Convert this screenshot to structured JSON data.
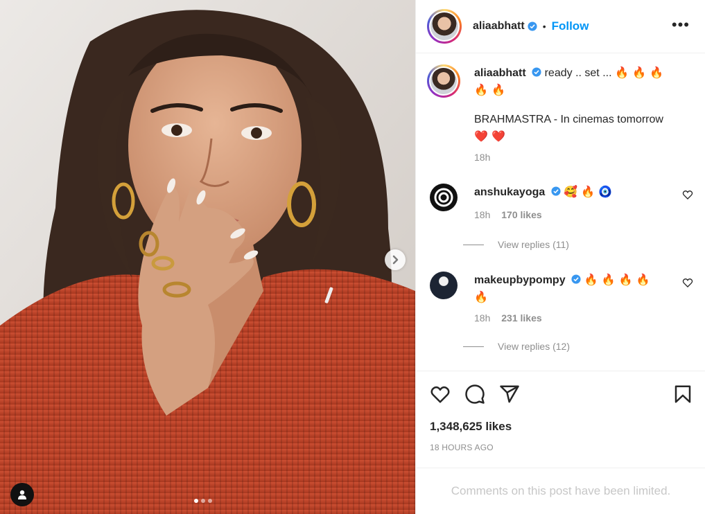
{
  "post": {
    "author": "aliaabhatt",
    "follow_label": "Follow",
    "separator": "•",
    "more_label": "•••"
  },
  "caption": {
    "username": "aliaabhatt",
    "text": "ready .. set ...",
    "emoji_line1": "🔥 🔥 🔥",
    "emoji_line2": "🔥 🔥",
    "line2": "BRAHMASTRA - In cinemas tomorrow",
    "hearts": "❤️ ❤️",
    "time": "18h"
  },
  "comments": [
    {
      "username": "anshukayoga",
      "text": "🥰 🔥 🧿",
      "time": "18h",
      "likes": "170 likes",
      "replies": "View replies (11)"
    },
    {
      "username": "makeupbypompy",
      "text": "🔥 🔥 🔥 🔥",
      "text2": "🔥",
      "time": "18h",
      "likes": "231 likes",
      "replies": "View replies (12)"
    }
  ],
  "likes_count": "1,348,625 likes",
  "timestamp": "18 HOURS AGO",
  "comments_limited": "Comments on this post have been limited.",
  "carousel": {
    "total": 3,
    "active": 1
  },
  "colors": {
    "accent": "#0095f6",
    "verified": "#3897f0",
    "muted": "#8e8e8e",
    "sweater": "#c2452c"
  },
  "icons": [
    "chevron-right-icon",
    "user-tag-icon",
    "verified-icon",
    "heart-icon",
    "comment-icon",
    "share-icon",
    "bookmark-icon"
  ]
}
